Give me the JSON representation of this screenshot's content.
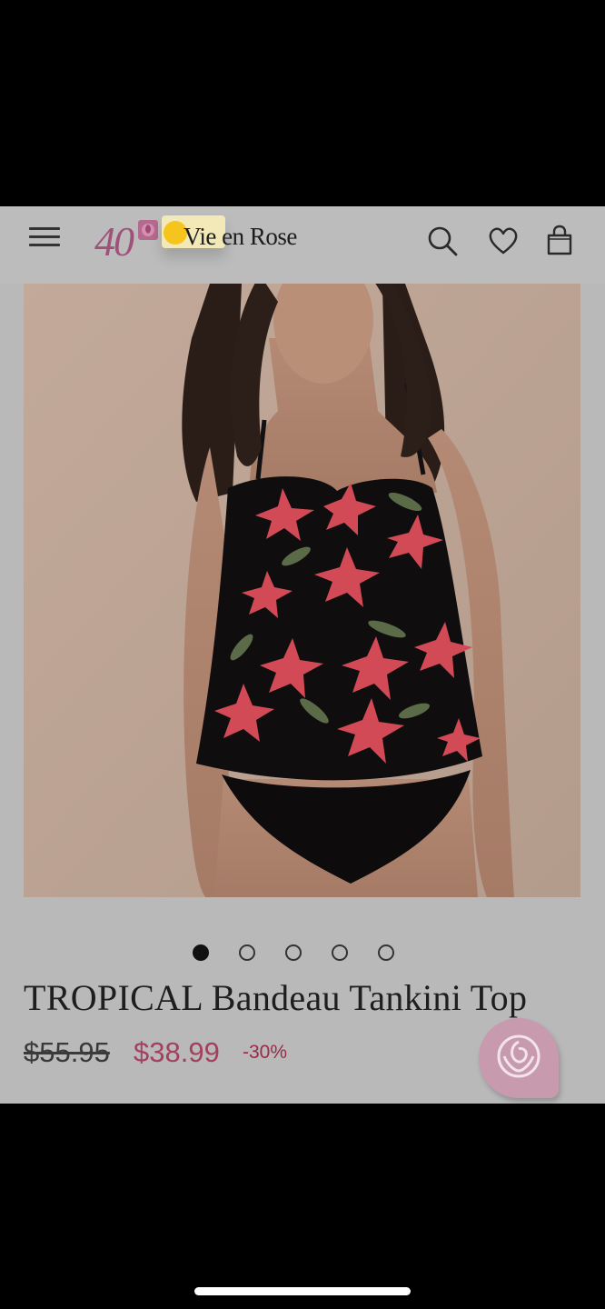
{
  "header": {
    "logo_number": "40",
    "logo_text": "Vie en Rose",
    "icons": [
      "menu-icon",
      "search-icon",
      "heart-icon",
      "bag-icon"
    ]
  },
  "product": {
    "title": "TROPICAL Bandeau Tankini Top",
    "original_price": "$55.95",
    "sale_price": "$38.99",
    "discount": "-30%",
    "image_count": 5,
    "active_image": 1
  },
  "colors": {
    "brand_pink": "#a0517a",
    "sale_price": "#a3405f",
    "discount": "#9a2a45",
    "overlay_gray": "#b9b9b9"
  }
}
